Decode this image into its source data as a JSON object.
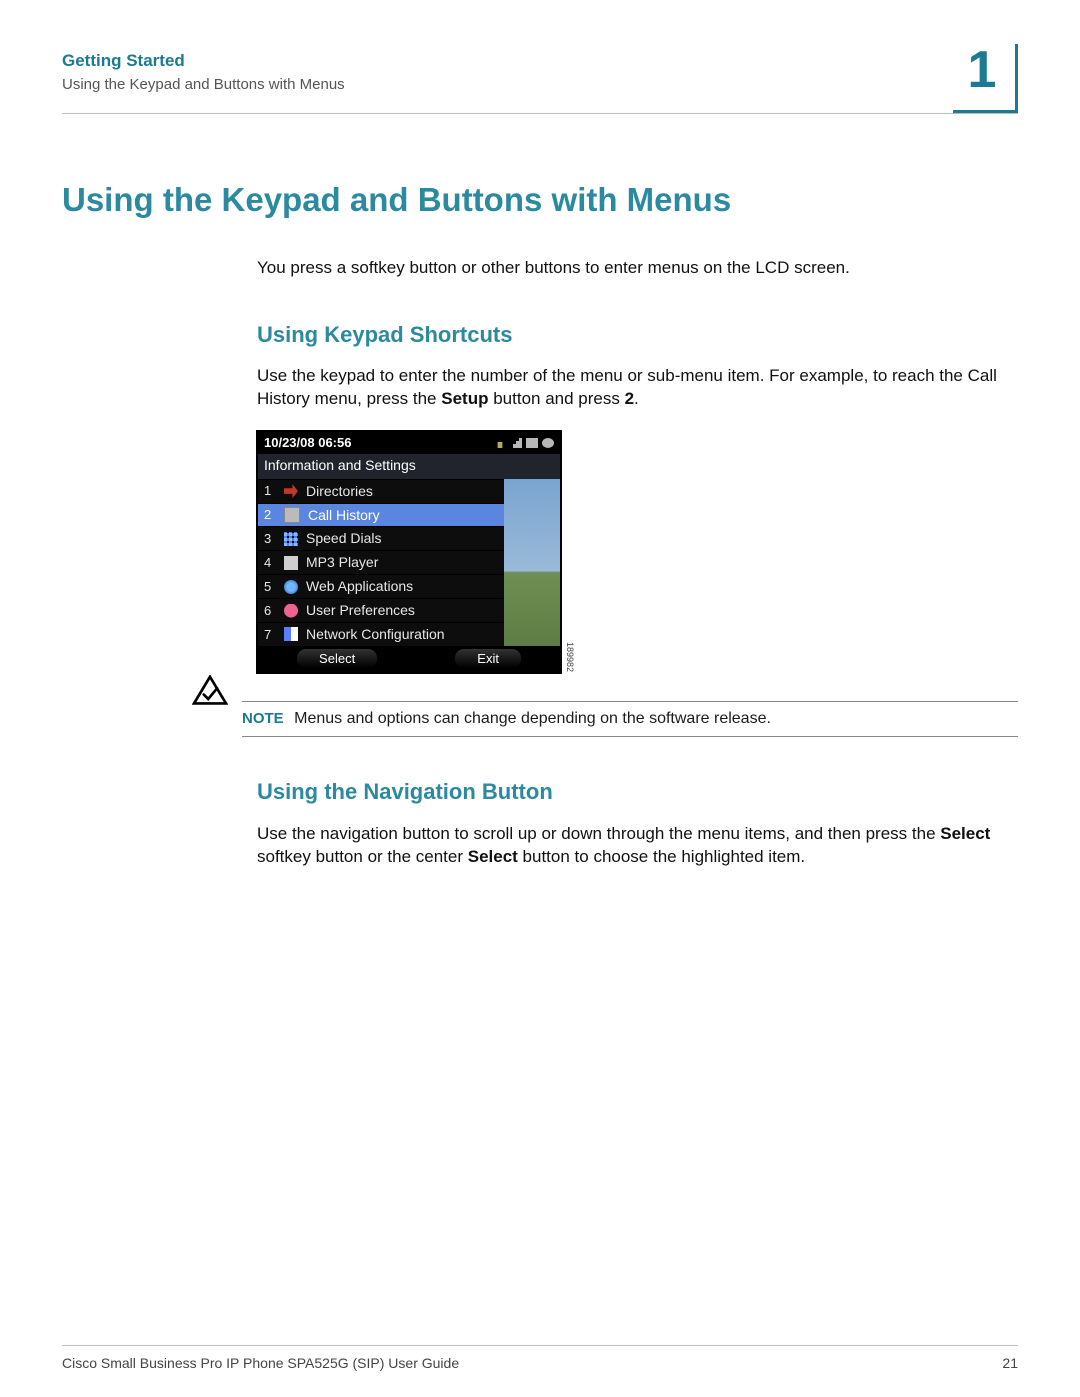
{
  "header": {
    "section": "Getting Started",
    "subsection": "Using the Keypad and Buttons with Menus",
    "chapter_number": "1"
  },
  "title": "Using the Keypad and Buttons with Menus",
  "intro": "You press a softkey button or other buttons to enter menus on the LCD screen.",
  "shortcuts": {
    "heading": "Using Keypad Shortcuts",
    "body_pre": "Use the keypad to enter the number of the menu or sub-menu item. For example, to reach the Call History menu, press the ",
    "body_bold1": "Setup",
    "body_mid": " button and press ",
    "body_bold2": "2",
    "body_post": "."
  },
  "lcd": {
    "datetime": "10/23/08 06:56",
    "panel_title": "Information and Settings",
    "items": [
      {
        "n": "1",
        "label": "Directories"
      },
      {
        "n": "2",
        "label": "Call History"
      },
      {
        "n": "3",
        "label": "Speed Dials"
      },
      {
        "n": "4",
        "label": "MP3 Player"
      },
      {
        "n": "5",
        "label": "Web Applications"
      },
      {
        "n": "6",
        "label": "User Preferences"
      },
      {
        "n": "7",
        "label": "Network Configuration"
      }
    ],
    "selected_index": 1,
    "softkeys": {
      "left": "Select",
      "right": "Exit"
    },
    "figure_id": "189982"
  },
  "note": {
    "label": "NOTE",
    "text": "Menus and options can change depending on the software release."
  },
  "nav": {
    "heading": "Using the Navigation Button",
    "body_pre": "Use the navigation button to scroll up or down through the menu items, and then press the ",
    "body_bold1": "Select",
    "body_mid": " softkey button or the center ",
    "body_bold2": "Select",
    "body_post": " button to choose the highlighted item."
  },
  "footer": {
    "left": "Cisco Small Business Pro IP Phone SPA525G (SIP) User Guide",
    "page": "21"
  }
}
